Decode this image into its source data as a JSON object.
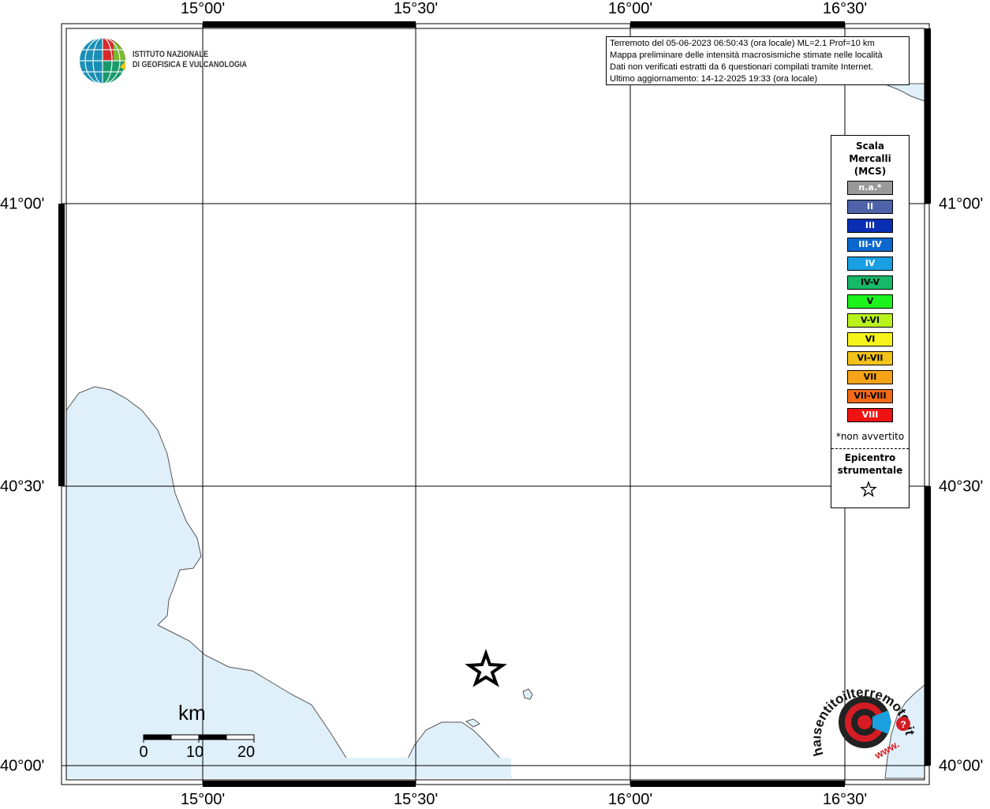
{
  "map": {
    "lon_ticks": [
      "15°00'",
      "15°30'",
      "16°00'",
      "16°30'"
    ],
    "lat_ticks": [
      "41°00'",
      "40°30'",
      "40°00'"
    ],
    "land_color": "#ffffff",
    "sea_color": "#e0f0fa"
  },
  "logo": {
    "line1": "ISTITUTO NAZIONALE",
    "line2": "DI GEOFISICA E VULCANOLOGIA"
  },
  "info": {
    "line1": "Terremoto del 05-06-2023 06:50:43 (ora locale) ML=2.1 Prof=10 km",
    "line2": "Mappa preliminare delle intensità macrosismiche stimate nelle località",
    "line3": "Dati non verificati estratti da 6 questionari compilati tramite Internet.",
    "line4": "Ultimo aggiornamento: 14-12-2025 19:33 (ora locale)"
  },
  "legend": {
    "title1": "Scala",
    "title2": "Mercalli",
    "title3": "(MCS)",
    "items": [
      {
        "label": "n.a.*",
        "color": "#999999"
      },
      {
        "label": "II",
        "color": "#4e63a9"
      },
      {
        "label": "III",
        "color": "#0a2fb3"
      },
      {
        "label": "III-IV",
        "color": "#0c68cf"
      },
      {
        "label": "IV",
        "color": "#1a9fe3"
      },
      {
        "label": "IV-V",
        "color": "#17b868"
      },
      {
        "label": "V",
        "color": "#1cf21c"
      },
      {
        "label": "V-VI",
        "color": "#b8f21a"
      },
      {
        "label": "VI",
        "color": "#f6f41a"
      },
      {
        "label": "VI-VII",
        "color": "#f2c219"
      },
      {
        "label": "VII",
        "color": "#f6a318"
      },
      {
        "label": "VII-VIII",
        "color": "#f26a16"
      },
      {
        "label": "VIII",
        "color": "#ef1212"
      }
    ],
    "note": "*non avvertito",
    "epicenter1": "Epicentro",
    "epicenter2": "strumentale"
  },
  "scale": {
    "unit": "km",
    "labels": [
      "0",
      "10",
      "20"
    ]
  },
  "badge": {
    "text": "haisentitoilterremoto.it",
    "prefix": "www."
  }
}
